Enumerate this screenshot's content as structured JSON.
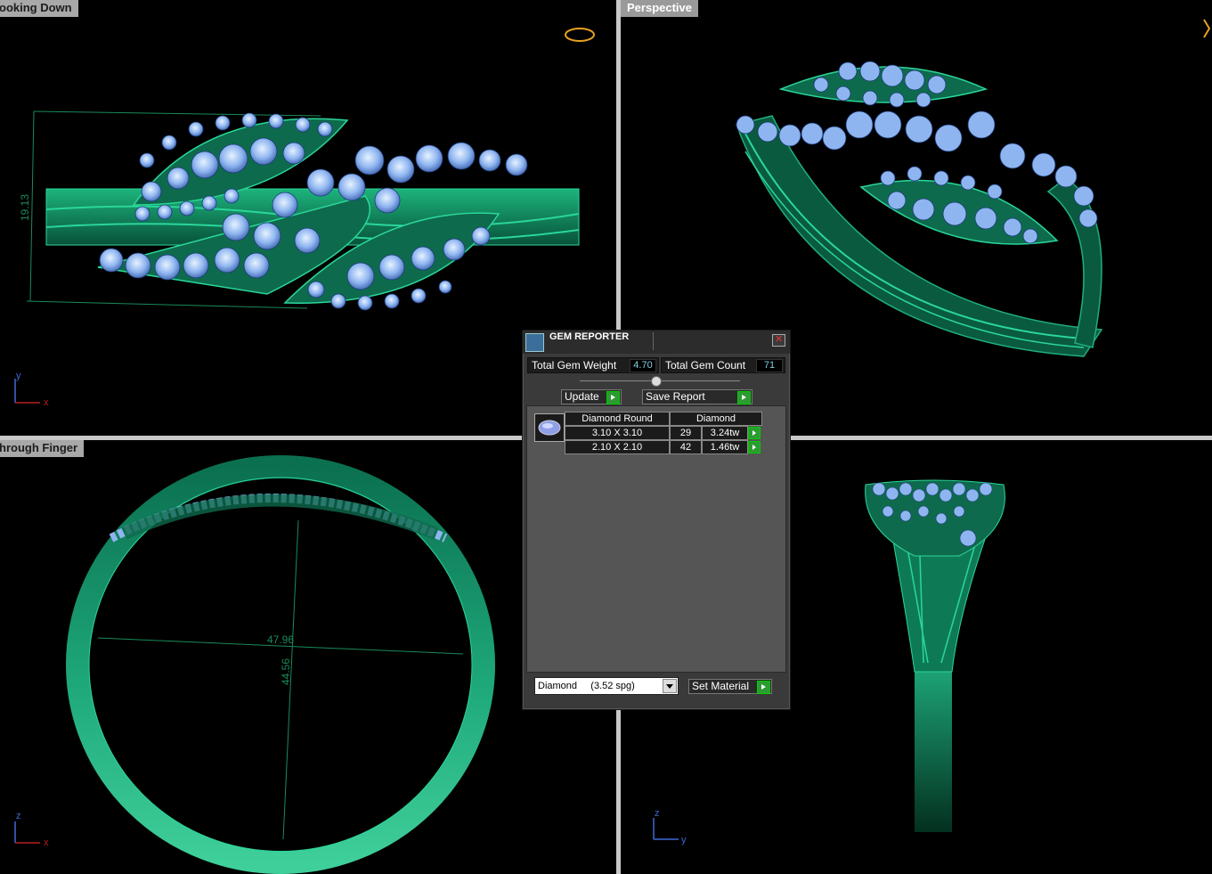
{
  "viewports": {
    "top_left": {
      "title": "ooking Down",
      "dimension": "19.13",
      "axis_a": "y",
      "axis_b": "x"
    },
    "top_right": {
      "title": "Perspective"
    },
    "bottom_left": {
      "title": "hrough Finger",
      "dim_horizontal": "47.96",
      "dim_vertical": "44.56",
      "axis_a": "z",
      "axis_b": "x"
    },
    "bottom_right": {
      "axis_a": "z",
      "axis_b": "y"
    }
  },
  "gem_reporter": {
    "title": "GEM REPORTER",
    "total_weight_label": "Total Gem Weight",
    "total_weight_value": "4.70",
    "total_count_label": "Total Gem Count",
    "total_count_value": "71",
    "update_label": "Update",
    "save_report_label": "Save Report",
    "table": {
      "header_cut": "Diamond Round",
      "header_material": "Diamond",
      "rows": [
        {
          "size": "3.10 X 3.10",
          "count": "29",
          "weight": "3.24tw"
        },
        {
          "size": "2.10 X 2.10",
          "count": "42",
          "weight": "1.46tw"
        }
      ]
    },
    "material_select": "Diamond     (3.52 spg)",
    "set_material_label": "Set Material"
  },
  "colors": {
    "metal": "#0f7a55",
    "gem": "#8eb8f0",
    "background": "#000000"
  }
}
